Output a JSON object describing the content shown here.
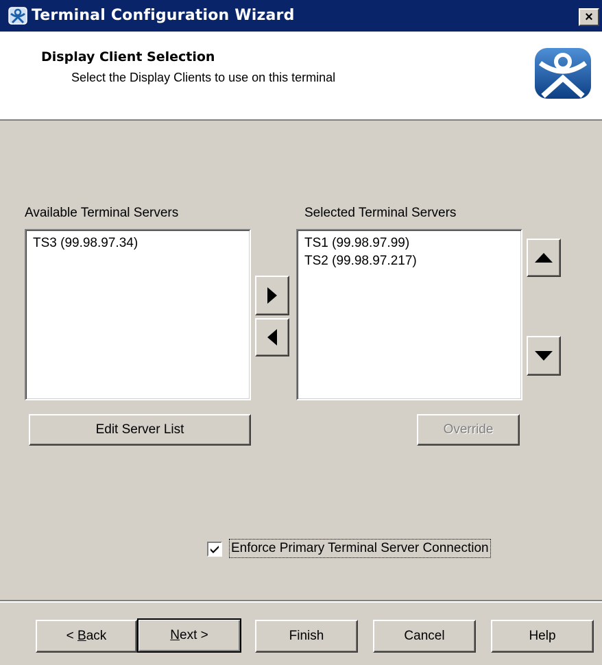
{
  "window": {
    "title": "Terminal Configuration Wizard",
    "close_label": "×"
  },
  "header": {
    "title": "Display Client Selection",
    "subtitle": "Select the Display Clients to use on this terminal"
  },
  "available": {
    "label": "Available Terminal Servers",
    "items": [
      "TS3 (99.98.97.34)"
    ]
  },
  "selected": {
    "label": "Selected Terminal Servers",
    "items": [
      "TS1 (99.98.97.99)",
      "TS2 (99.98.97.217)"
    ]
  },
  "buttons": {
    "edit_server_list": "Edit Server List",
    "override": "Override",
    "back_prefix": "< ",
    "back_accel": "B",
    "back_rest": "ack",
    "next_accel": "N",
    "next_rest": "ext >",
    "finish": "Finish",
    "cancel": "Cancel",
    "help": "Help"
  },
  "enforce_primary": {
    "label": "Enforce Primary Terminal Server Connection",
    "checked": true
  },
  "colors": {
    "title_bar": "#0a246a",
    "face": "#d4d0c8",
    "logo_blue": "#1a5fa8"
  }
}
